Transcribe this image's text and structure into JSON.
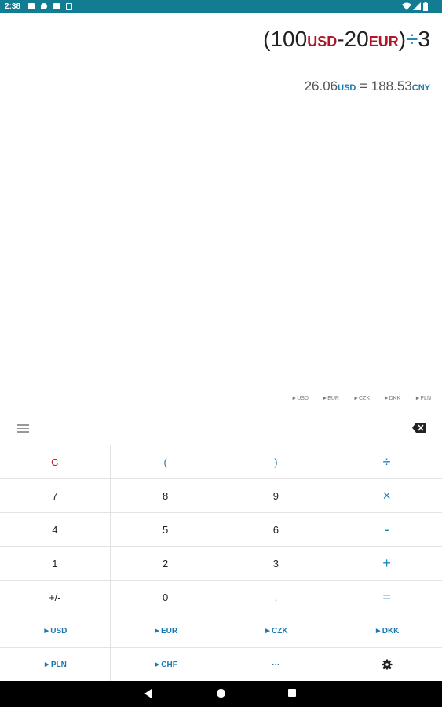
{
  "status_bar": {
    "time": "2:38",
    "icons": [
      "notification-icon",
      "drop-icon",
      "sd-card-icon",
      "android-icon",
      "wifi-icon",
      "signal-icon",
      "battery-icon"
    ]
  },
  "expression": {
    "open": "(",
    "a": "100",
    "a_cur": "USD",
    "minus": "-",
    "b": "20",
    "b_cur": "EUR",
    "close": ")",
    "div": "÷",
    "c": "3"
  },
  "result": {
    "from_value": "26.06",
    "from_cur": "USD",
    "equals": "=",
    "to_value": "188.53",
    "to_cur": "CNY"
  },
  "quick_currencies": [
    "►USD",
    "►EUR",
    "►CZK",
    "►DKK",
    "►PLN"
  ],
  "keys": [
    {
      "label": "C",
      "style": "red"
    },
    {
      "label": "(",
      "style": "blue"
    },
    {
      "label": ")",
      "style": "blue"
    },
    {
      "label": "÷",
      "style": "op"
    },
    {
      "label": "7",
      "style": ""
    },
    {
      "label": "8",
      "style": ""
    },
    {
      "label": "9",
      "style": ""
    },
    {
      "label": "×",
      "style": "op"
    },
    {
      "label": "4",
      "style": ""
    },
    {
      "label": "5",
      "style": ""
    },
    {
      "label": "6",
      "style": ""
    },
    {
      "label": "-",
      "style": "op"
    },
    {
      "label": "1",
      "style": ""
    },
    {
      "label": "2",
      "style": ""
    },
    {
      "label": "3",
      "style": ""
    },
    {
      "label": "+",
      "style": "op"
    },
    {
      "label": "+/-",
      "style": ""
    },
    {
      "label": "0",
      "style": ""
    },
    {
      "label": ".",
      "style": ""
    },
    {
      "label": "=",
      "style": "op"
    },
    {
      "label": "►USD",
      "style": "cur"
    },
    {
      "label": "►EUR",
      "style": "cur"
    },
    {
      "label": "►CZK",
      "style": "cur"
    },
    {
      "label": "►DKK",
      "style": "cur"
    },
    {
      "label": "►PLN",
      "style": "cur"
    },
    {
      "label": "►CHF",
      "style": "cur"
    },
    {
      "label": "···",
      "style": "cur"
    },
    {
      "label": "gear-icon",
      "style": "icon"
    }
  ],
  "colors": {
    "status_bar": "#127c93",
    "currency_red": "#b0162a",
    "accent_blue": "#1a79b0"
  }
}
